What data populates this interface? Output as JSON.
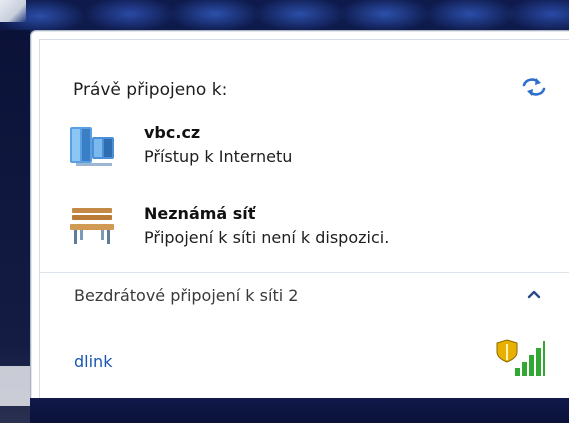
{
  "popup": {
    "heading": "Právě připojeno k:",
    "networks": [
      {
        "name": "vbc.cz",
        "status": "Přístup k Internetu",
        "icon": "network-building-icon"
      },
      {
        "name": "Neznámá síť",
        "status": "Připojení k síti není k dispozici.",
        "icon": "park-bench-icon"
      }
    ],
    "wireless": {
      "section_label": "Bezdrátové připojení k síti 2",
      "expanded": true,
      "items": [
        {
          "ssid": "dlink",
          "secured": true,
          "signal_bars": 5
        }
      ]
    }
  },
  "colors": {
    "link": "#1a56b0",
    "refresh_icon": "#2e6fc9",
    "signal": "#32a832",
    "shield": "#e8b000"
  }
}
